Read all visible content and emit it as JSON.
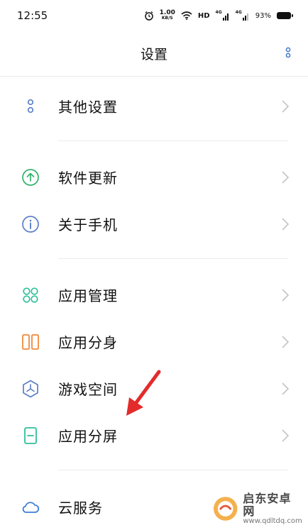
{
  "status_bar": {
    "time": "12:55",
    "speed_value": "1.00",
    "speed_unit": "KB/S",
    "hd": "HD",
    "network1": "4G",
    "network2": "4G",
    "battery": "93%"
  },
  "header": {
    "title": "设置",
    "more_icon": "more-vertical-icon"
  },
  "items": [
    {
      "label": "其他设置",
      "icon": "more-dots-icon",
      "color": "#5a7fc8"
    },
    {
      "label": "软件更新",
      "icon": "upload-arrow-icon",
      "color": "#2fb36a"
    },
    {
      "label": "关于手机",
      "icon": "info-icon",
      "color": "#5a7fc8"
    },
    {
      "label": "应用管理",
      "icon": "grid-four-icon",
      "color": "#2fbf9a"
    },
    {
      "label": "应用分身",
      "icon": "split-squares-icon",
      "color": "#f08a3c"
    },
    {
      "label": "游戏空间",
      "icon": "hexagon-icon",
      "color": "#5a7fc8"
    },
    {
      "label": "应用分屏",
      "icon": "split-screen-icon",
      "color": "#2fbf9a"
    },
    {
      "label": "云服务",
      "icon": "cloud-icon",
      "color": "#3a7fd8"
    }
  ],
  "colors": {
    "annotation_arrow": "#e32b2b",
    "divider": "#ececec",
    "chevron": "#c4c4c4"
  },
  "watermark": {
    "title": "启东安卓网",
    "sub": "www.qdltdq.com"
  }
}
